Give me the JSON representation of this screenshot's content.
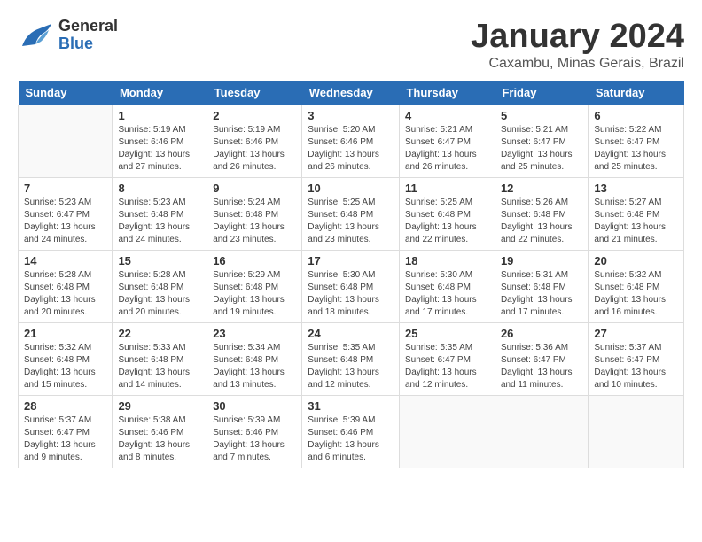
{
  "header": {
    "logo_general": "General",
    "logo_blue": "Blue",
    "month_title": "January 2024",
    "subtitle": "Caxambu, Minas Gerais, Brazil"
  },
  "days_of_week": [
    "Sunday",
    "Monday",
    "Tuesday",
    "Wednesday",
    "Thursday",
    "Friday",
    "Saturday"
  ],
  "weeks": [
    [
      {
        "day": "",
        "info": ""
      },
      {
        "day": "1",
        "info": "Sunrise: 5:19 AM\nSunset: 6:46 PM\nDaylight: 13 hours\nand 27 minutes."
      },
      {
        "day": "2",
        "info": "Sunrise: 5:19 AM\nSunset: 6:46 PM\nDaylight: 13 hours\nand 26 minutes."
      },
      {
        "day": "3",
        "info": "Sunrise: 5:20 AM\nSunset: 6:46 PM\nDaylight: 13 hours\nand 26 minutes."
      },
      {
        "day": "4",
        "info": "Sunrise: 5:21 AM\nSunset: 6:47 PM\nDaylight: 13 hours\nand 26 minutes."
      },
      {
        "day": "5",
        "info": "Sunrise: 5:21 AM\nSunset: 6:47 PM\nDaylight: 13 hours\nand 25 minutes."
      },
      {
        "day": "6",
        "info": "Sunrise: 5:22 AM\nSunset: 6:47 PM\nDaylight: 13 hours\nand 25 minutes."
      }
    ],
    [
      {
        "day": "7",
        "info": "Sunrise: 5:23 AM\nSunset: 6:47 PM\nDaylight: 13 hours\nand 24 minutes."
      },
      {
        "day": "8",
        "info": "Sunrise: 5:23 AM\nSunset: 6:48 PM\nDaylight: 13 hours\nand 24 minutes."
      },
      {
        "day": "9",
        "info": "Sunrise: 5:24 AM\nSunset: 6:48 PM\nDaylight: 13 hours\nand 23 minutes."
      },
      {
        "day": "10",
        "info": "Sunrise: 5:25 AM\nSunset: 6:48 PM\nDaylight: 13 hours\nand 23 minutes."
      },
      {
        "day": "11",
        "info": "Sunrise: 5:25 AM\nSunset: 6:48 PM\nDaylight: 13 hours\nand 22 minutes."
      },
      {
        "day": "12",
        "info": "Sunrise: 5:26 AM\nSunset: 6:48 PM\nDaylight: 13 hours\nand 22 minutes."
      },
      {
        "day": "13",
        "info": "Sunrise: 5:27 AM\nSunset: 6:48 PM\nDaylight: 13 hours\nand 21 minutes."
      }
    ],
    [
      {
        "day": "14",
        "info": "Sunrise: 5:28 AM\nSunset: 6:48 PM\nDaylight: 13 hours\nand 20 minutes."
      },
      {
        "day": "15",
        "info": "Sunrise: 5:28 AM\nSunset: 6:48 PM\nDaylight: 13 hours\nand 20 minutes."
      },
      {
        "day": "16",
        "info": "Sunrise: 5:29 AM\nSunset: 6:48 PM\nDaylight: 13 hours\nand 19 minutes."
      },
      {
        "day": "17",
        "info": "Sunrise: 5:30 AM\nSunset: 6:48 PM\nDaylight: 13 hours\nand 18 minutes."
      },
      {
        "day": "18",
        "info": "Sunrise: 5:30 AM\nSunset: 6:48 PM\nDaylight: 13 hours\nand 17 minutes."
      },
      {
        "day": "19",
        "info": "Sunrise: 5:31 AM\nSunset: 6:48 PM\nDaylight: 13 hours\nand 17 minutes."
      },
      {
        "day": "20",
        "info": "Sunrise: 5:32 AM\nSunset: 6:48 PM\nDaylight: 13 hours\nand 16 minutes."
      }
    ],
    [
      {
        "day": "21",
        "info": "Sunrise: 5:32 AM\nSunset: 6:48 PM\nDaylight: 13 hours\nand 15 minutes."
      },
      {
        "day": "22",
        "info": "Sunrise: 5:33 AM\nSunset: 6:48 PM\nDaylight: 13 hours\nand 14 minutes."
      },
      {
        "day": "23",
        "info": "Sunrise: 5:34 AM\nSunset: 6:48 PM\nDaylight: 13 hours\nand 13 minutes."
      },
      {
        "day": "24",
        "info": "Sunrise: 5:35 AM\nSunset: 6:48 PM\nDaylight: 13 hours\nand 12 minutes."
      },
      {
        "day": "25",
        "info": "Sunrise: 5:35 AM\nSunset: 6:47 PM\nDaylight: 13 hours\nand 12 minutes."
      },
      {
        "day": "26",
        "info": "Sunrise: 5:36 AM\nSunset: 6:47 PM\nDaylight: 13 hours\nand 11 minutes."
      },
      {
        "day": "27",
        "info": "Sunrise: 5:37 AM\nSunset: 6:47 PM\nDaylight: 13 hours\nand 10 minutes."
      }
    ],
    [
      {
        "day": "28",
        "info": "Sunrise: 5:37 AM\nSunset: 6:47 PM\nDaylight: 13 hours\nand 9 minutes."
      },
      {
        "day": "29",
        "info": "Sunrise: 5:38 AM\nSunset: 6:46 PM\nDaylight: 13 hours\nand 8 minutes."
      },
      {
        "day": "30",
        "info": "Sunrise: 5:39 AM\nSunset: 6:46 PM\nDaylight: 13 hours\nand 7 minutes."
      },
      {
        "day": "31",
        "info": "Sunrise: 5:39 AM\nSunset: 6:46 PM\nDaylight: 13 hours\nand 6 minutes."
      },
      {
        "day": "",
        "info": ""
      },
      {
        "day": "",
        "info": ""
      },
      {
        "day": "",
        "info": ""
      }
    ]
  ]
}
